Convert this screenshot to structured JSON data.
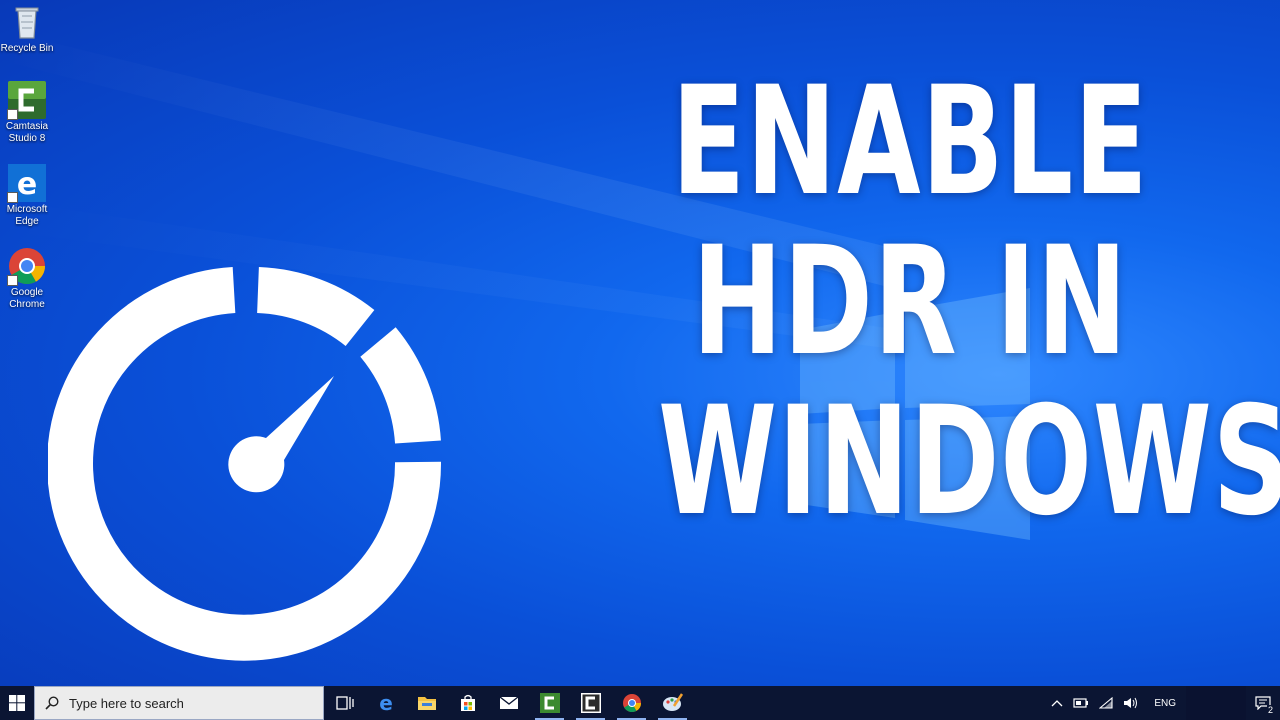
{
  "desktop": {
    "icons": [
      {
        "label_line1": "Recycle Bin",
        "label_line2": "",
        "icon": "recycle-bin-icon"
      },
      {
        "label_line1": "Camtasia",
        "label_line2": "Studio 8",
        "icon": "camtasia-icon"
      },
      {
        "label_line1": "Microsoft",
        "label_line2": "Edge",
        "icon": "edge-icon"
      },
      {
        "label_line1": "Google",
        "label_line2": "Chrome",
        "icon": "chrome-icon"
      }
    ]
  },
  "headline": {
    "line1": "ENABLE",
    "line2": "HDR IN",
    "line3": "WINDOWS"
  },
  "overlay_icon": "speedometer-icon",
  "taskbar": {
    "search_placeholder": "Type here to search",
    "pinned": [
      "task-view-icon",
      "edge-icon",
      "file-explorer-icon",
      "store-icon",
      "mail-icon",
      "camtasia-recorder-icon",
      "camtasia-studio-icon",
      "chrome-icon",
      "paint-icon"
    ],
    "tray": {
      "language": "ENG",
      "notification_count": "2"
    }
  },
  "colors": {
    "wallpaper_dark": "#0839b8",
    "wallpaper_light": "#2f88ff",
    "taskbar": "#0b1533",
    "headline": "#ffffff"
  }
}
